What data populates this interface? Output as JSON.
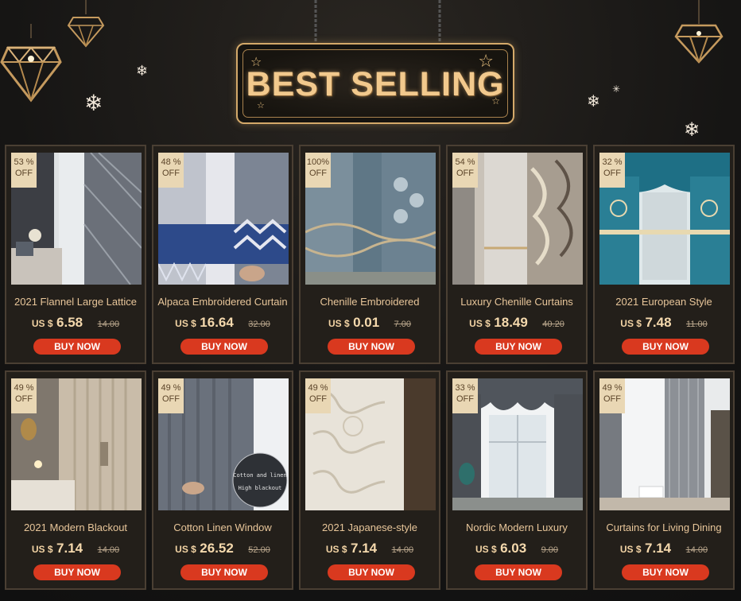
{
  "banner": {
    "title": "BEST SELLING"
  },
  "products": [
    {
      "discount_pct": "53 %",
      "discount_off": "OFF",
      "name": "2021 Flannel Large Lattice",
      "currency": "US $",
      "price": "6.58",
      "old_price": "14.00",
      "button": "BUY NOW",
      "palette": "grey-lattice"
    },
    {
      "discount_pct": "48 %",
      "discount_off": "OFF",
      "name": "Alpaca Embroidered Curtain",
      "currency": "US $",
      "price": "16.64",
      "old_price": "32.00",
      "button": "BUY NOW",
      "palette": "blue-embroidered"
    },
    {
      "discount_pct": "100%",
      "discount_off": "OFF",
      "name": "Chenille Embroidered",
      "currency": "US $",
      "price": "0.01",
      "old_price": "7.00",
      "button": "BUY NOW",
      "palette": "slate-embroidered"
    },
    {
      "discount_pct": "54 %",
      "discount_off": "OFF",
      "name": "Luxury Chenille Curtains",
      "currency": "US $",
      "price": "18.49",
      "old_price": "40.20",
      "button": "BUY NOW",
      "palette": "gold-damask"
    },
    {
      "discount_pct": "32 %",
      "discount_off": "OFF",
      "name": "2021 European Style",
      "currency": "US $",
      "price": "7.48",
      "old_price": "11.00",
      "button": "BUY NOW",
      "palette": "teal-european"
    },
    {
      "discount_pct": "49 %",
      "discount_off": "OFF",
      "name": "2021 Modern Blackout",
      "currency": "US $",
      "price": "7.14",
      "old_price": "14.00",
      "button": "BUY NOW",
      "palette": "beige-blackout"
    },
    {
      "discount_pct": "49 %",
      "discount_off": "OFF",
      "name": "Cotton Linen Window",
      "currency": "US $",
      "price": "26.52",
      "old_price": "52.00",
      "button": "BUY NOW",
      "palette": "grey-linen",
      "overlay_line1": "Cotton and linen",
      "overlay_line2": "High blackout"
    },
    {
      "discount_pct": "49 %",
      "discount_off": "OFF",
      "name": "2021 Japanese-style",
      "currency": "US $",
      "price": "7.14",
      "old_price": "14.00",
      "button": "BUY NOW",
      "palette": "cream-lace"
    },
    {
      "discount_pct": "33 %",
      "discount_off": "OFF",
      "name": "Nordic Modern Luxury",
      "currency": "US $",
      "price": "6.03",
      "old_price": "9.00",
      "button": "BUY NOW",
      "palette": "charcoal-valance"
    },
    {
      "discount_pct": "49 %",
      "discount_off": "OFF",
      "name": "Curtains for Living Dining",
      "currency": "US $",
      "price": "7.14",
      "old_price": "14.00",
      "button": "BUY NOW",
      "palette": "silver-sheer"
    }
  ],
  "colors": {
    "accent_button": "#d9391f",
    "gold_text": "#e8c69a",
    "badge_bg": "#e9d7b4"
  },
  "icons": [
    "diamond-lamp-icon",
    "snowflake-icon",
    "star-icon"
  ]
}
